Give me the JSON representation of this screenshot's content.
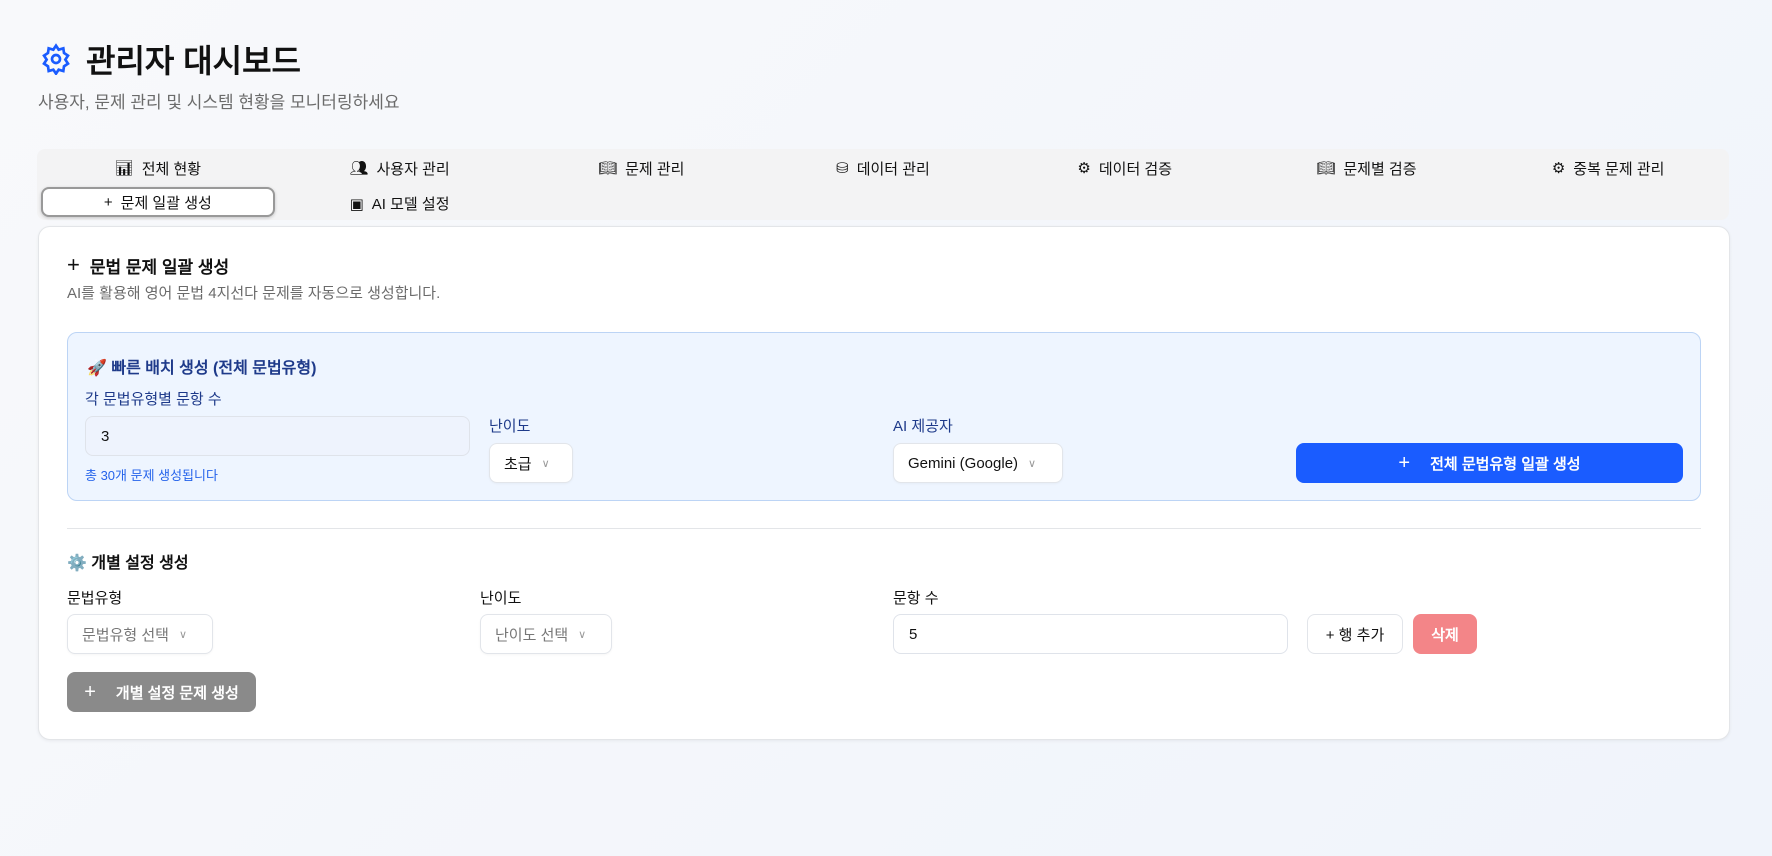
{
  "header": {
    "title": "관리자 대시보드",
    "subtitle": "사용자, 문제 관리 및 시스템 현황을 모니터링하세요"
  },
  "tabs": [
    {
      "label": "전체 현황",
      "icon": "bar-chart-icon"
    },
    {
      "label": "사용자 관리",
      "icon": "users-icon"
    },
    {
      "label": "문제 관리",
      "icon": "book-icon"
    },
    {
      "label": "데이터 관리",
      "icon": "database-icon"
    },
    {
      "label": "데이터 검증",
      "icon": "gear-icon"
    },
    {
      "label": "문제별 검증",
      "icon": "book-icon"
    },
    {
      "label": "중복 문제 관리",
      "icon": "gear-icon"
    },
    {
      "label": "문제 일괄 생성",
      "icon": "plus-icon",
      "active": true
    },
    {
      "label": "AI 모델 설정",
      "icon": "cpu-icon"
    }
  ],
  "card": {
    "title": "문법 문제 일괄 생성",
    "description": "AI를 활용해 영어 문법 4지선다 문제를 자동으로 생성합니다.",
    "quick": {
      "title": "🚀 빠른 배치 생성 (전체 문법유형)",
      "count_label": "각 문법유형별 문항 수",
      "count_value": "3",
      "hint": "총 30개 문제 생성됩니다",
      "difficulty_label": "난이도",
      "difficulty_value": "초급",
      "provider_label": "AI 제공자",
      "provider_value": "Gemini (Google)",
      "generate_button": "전체 문법유형 일괄 생성"
    },
    "individual": {
      "title": "⚙️ 개별 설정 생성",
      "type_label": "문법유형",
      "type_placeholder": "문법유형 선택",
      "difficulty_label": "난이도",
      "difficulty_placeholder": "난이도 선택",
      "count_label": "문항 수",
      "count_value": "5",
      "add_row": "+ 행 추가",
      "delete": "삭제",
      "generate_button": "개별 설정 문제 생성"
    }
  },
  "colors": {
    "accent": "#1a5cff",
    "danger": "#f38588",
    "disabled": "#8a8a8a"
  }
}
